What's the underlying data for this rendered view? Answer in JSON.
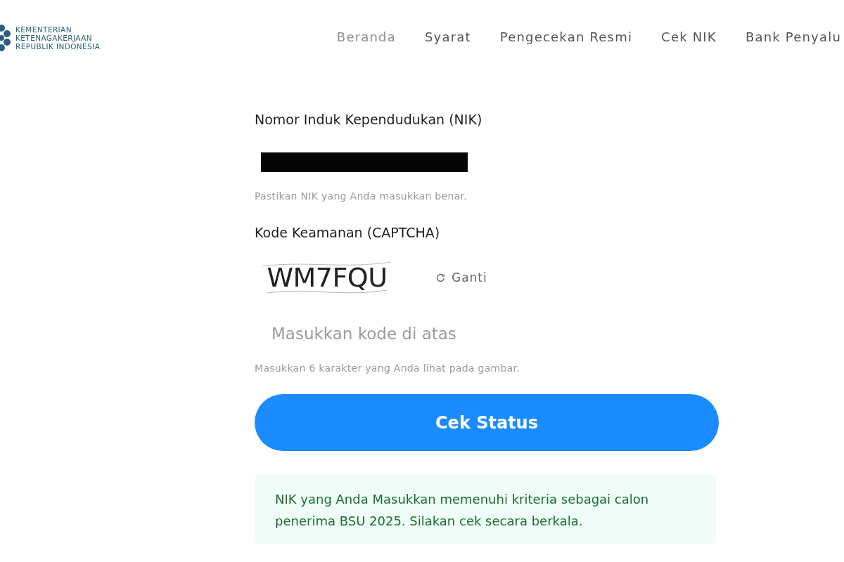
{
  "header": {
    "logo": {
      "lines": [
        "KEMENTERIAN",
        "KETENAGAKERJAAN",
        "REPUBLIK INDONESIA"
      ]
    },
    "nav": [
      {
        "label": "Beranda",
        "selected": true
      },
      {
        "label": "Syarat",
        "selected": false
      },
      {
        "label": "Pengecekan Resmi",
        "selected": false
      },
      {
        "label": "Cek NIK",
        "selected": false
      },
      {
        "label": "Bank Penyalu",
        "selected": false
      }
    ]
  },
  "form": {
    "nik": {
      "label": "Nomor Induk Kependudukan (NIK)",
      "hint": "Pastikan NIK yang Anda masukkan benar."
    },
    "captcha": {
      "label": "Kode Keamanan (CAPTCHA)",
      "code": "WM7FQU",
      "refresh_label": "Ganti",
      "placeholder": "Masukkan kode di atas",
      "hint": "Masukkan 6 karakter yang Anda lihat pada gambar."
    },
    "submit": "Cek Status",
    "result": {
      "kind": "success",
      "message": "NIK yang Anda Masukkan memenuhi kriteria sebagai calon penerima BSU 2025. Silakan cek secara berkala."
    }
  }
}
